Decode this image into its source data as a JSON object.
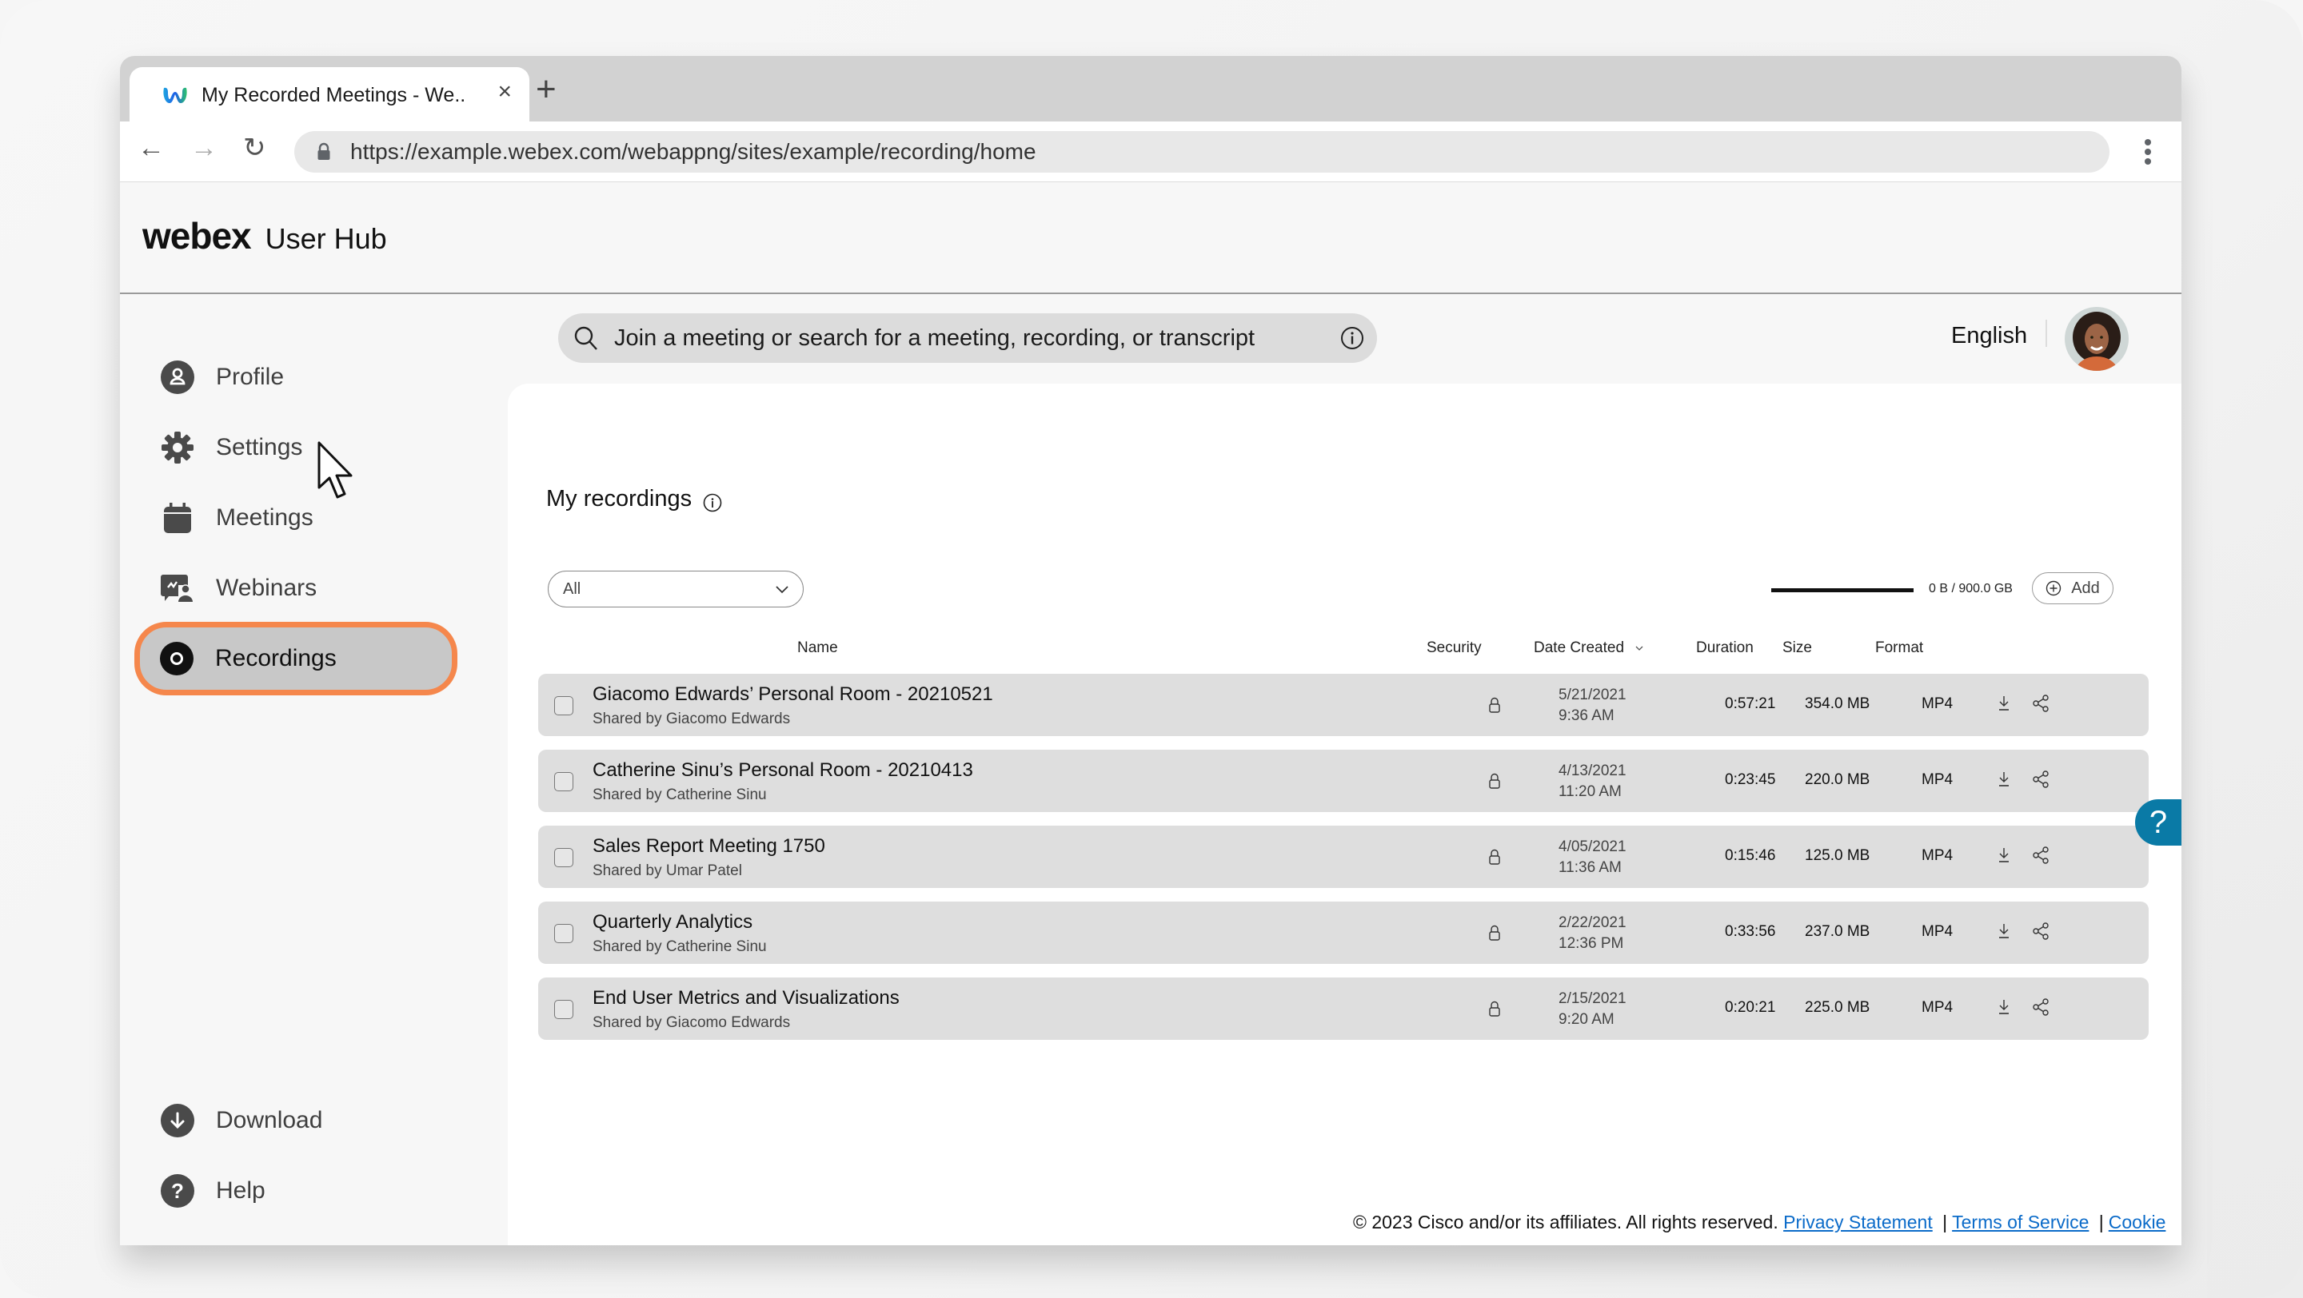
{
  "browser": {
    "tab_title": "My Recorded Meetings - We..",
    "tab_close": "×",
    "new_tab": "+",
    "url": "https://example.webex.com/webappng/sites/example/recording/home",
    "nav": {
      "back": "←",
      "forward": "→",
      "reload": "↻"
    }
  },
  "header": {
    "brand": "webex",
    "product": "User Hub"
  },
  "sidebar": {
    "items": [
      {
        "label": "Profile",
        "icon": "profile-icon"
      },
      {
        "label": "Settings",
        "icon": "gear-icon"
      },
      {
        "label": "Meetings",
        "icon": "calendar-icon"
      },
      {
        "label": "Webinars",
        "icon": "webinar-icon"
      },
      {
        "label": "Recordings",
        "icon": "recording-icon",
        "active": true
      }
    ],
    "bottom_items": [
      {
        "label": "Download",
        "icon": "download-icon"
      },
      {
        "label": "Help",
        "icon": "help-icon"
      }
    ]
  },
  "topbar": {
    "search_placeholder": "Join a meeting or search for a meeting, recording, or transcript",
    "language": "English"
  },
  "main": {
    "title": "My recordings",
    "filter": {
      "selected": "All"
    },
    "storage": {
      "text": "0 B / 900.0 GB",
      "used_fraction": 0.0
    },
    "add_label": "Add",
    "columns": [
      "Name",
      "Security",
      "Date Created",
      "Duration",
      "Size",
      "Format"
    ],
    "sort_column": "Date Created",
    "rows": [
      {
        "name": "Giacomo Edwards’ Personal Room - 20210521",
        "shared_by": "Shared by Giacomo Edwards",
        "date": "5/21/2021",
        "time": "9:36 AM",
        "duration": "0:57:21",
        "size": "354.0 MB",
        "format": "MP4"
      },
      {
        "name": "Catherine Sinu’s Personal Room - 20210413",
        "shared_by": "Shared by Catherine Sinu",
        "date": "4/13/2021",
        "time": "11:20 AM",
        "duration": "0:23:45",
        "size": "220.0 MB",
        "format": "MP4"
      },
      {
        "name": "Sales Report Meeting 1750",
        "shared_by": "Shared by Umar Patel",
        "date": "4/05/2021",
        "time": "11:36 AM",
        "duration": "0:15:46",
        "size": "125.0 MB",
        "format": "MP4"
      },
      {
        "name": "Quarterly Analytics",
        "shared_by": "Shared by Catherine Sinu",
        "date": "2/22/2021",
        "time": "12:36 PM",
        "duration": "0:33:56",
        "size": "237.0 MB",
        "format": "MP4"
      },
      {
        "name": "End User Metrics and Visualizations",
        "shared_by": "Shared by Giacomo Edwards",
        "date": "2/15/2021",
        "time": "9:20 AM",
        "duration": "0:20:21",
        "size": "225.0 MB",
        "format": "MP4"
      }
    ]
  },
  "help_float": "?",
  "footer": {
    "copyright": "© 2023 Cisco and/or its affiliates. All rights reserved.",
    "links": [
      "Privacy Statement",
      "Terms of Service",
      "Cookie"
    ],
    "separator": "|"
  },
  "colors": {
    "accent_highlight": "#f5874c",
    "help_button": "#0a7aa6",
    "link": "#0b6bc9",
    "row_bg": "#dedede"
  }
}
